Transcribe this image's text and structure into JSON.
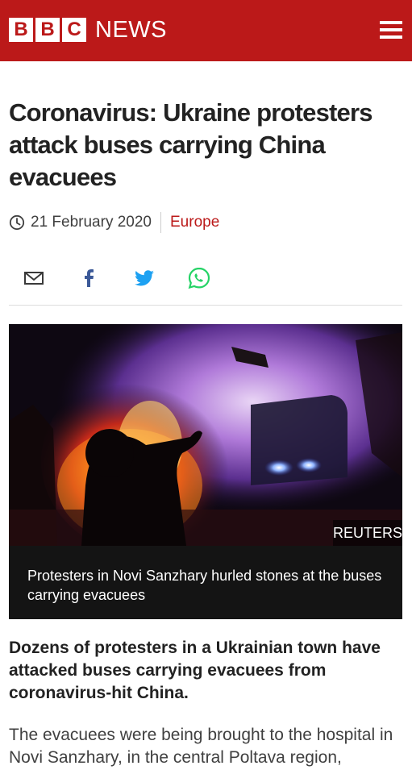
{
  "header": {
    "logo_letters": [
      "B",
      "B",
      "C"
    ],
    "logo_word": "NEWS",
    "menu_icon": "hamburger-menu-icon"
  },
  "article": {
    "headline": "Coronavirus: Ukraine protesters attack buses carrying China evacuees",
    "date": "21 February 2020",
    "section": "Europe",
    "share": {
      "icons": [
        "email-icon",
        "facebook-icon",
        "twitter-icon",
        "whatsapp-icon"
      ]
    },
    "figure": {
      "credit": "REUTERS",
      "caption": "Protesters in Novi Sanzhary hurled stones at the buses carrying evacuees"
    },
    "intro": "Dozens of protesters in a Ukrainian town have attacked buses carrying evacuees from coronavirus-hit China.",
    "body": "The evacuees were being brought to the hospital in Novi Sanzhary, in the central Poltava region,"
  },
  "colors": {
    "brand_red": "#bb1919",
    "facebook": "#3b5998",
    "twitter": "#1da1f2",
    "whatsapp": "#25d366",
    "caption_bg": "#141414"
  }
}
